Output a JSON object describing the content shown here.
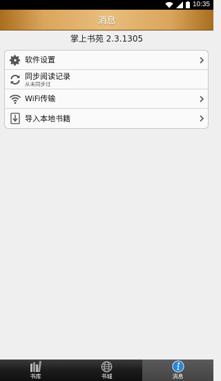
{
  "status_bar": {
    "time": "10:35"
  },
  "header": {
    "title": "消息"
  },
  "app": {
    "version_text": "掌上书苑 2.3.1305"
  },
  "menu": {
    "items": [
      {
        "label": "软件设置",
        "sub": "",
        "icon": "gear-icon"
      },
      {
        "label": "同步阅读记录",
        "sub": "从未同步过",
        "icon": "sync-icon"
      },
      {
        "label": "WiFi传输",
        "sub": "",
        "icon": "wifi-icon"
      },
      {
        "label": "导入本地书籍",
        "sub": "",
        "icon": "import-icon"
      }
    ]
  },
  "tabbar": {
    "tabs": [
      {
        "label": "书库",
        "icon": "bookshelf-icon",
        "active": false
      },
      {
        "label": "书城",
        "icon": "globe-icon",
        "active": false
      },
      {
        "label": "消息",
        "icon": "info-icon",
        "active": true
      }
    ]
  },
  "colors": {
    "header_gold": "#d9a55c",
    "tabbar_dark": "#1c1c1c",
    "info_blue": "#2a86d6"
  }
}
